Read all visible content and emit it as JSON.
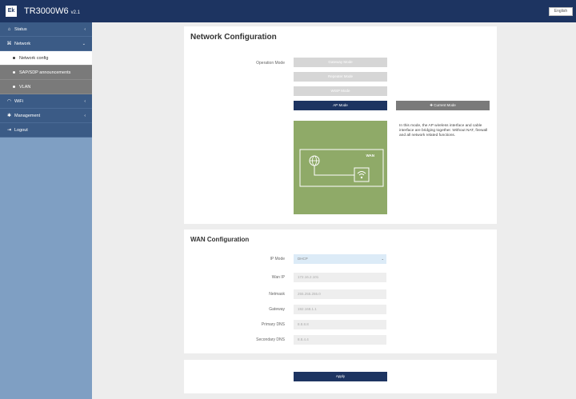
{
  "header": {
    "logo_text": "Ek",
    "product_name": "TR3000W6",
    "version": "v2.1",
    "language": "English"
  },
  "sidebar": {
    "items": [
      {
        "label": "Status",
        "icon": "home-icon",
        "caret": "‹"
      },
      {
        "label": "Network",
        "icon": "network-icon",
        "caret": "⌄"
      },
      {
        "label": "Network config",
        "sub": true,
        "active": true
      },
      {
        "label": "SAP/SDP announcements",
        "sub": true
      },
      {
        "label": "VLAN",
        "sub": true
      },
      {
        "label": "WiFi",
        "icon": "wifi-icon",
        "caret": "‹"
      },
      {
        "label": "Management",
        "icon": "gear-icon",
        "caret": "‹"
      },
      {
        "label": "Logout",
        "icon": "logout-icon"
      }
    ]
  },
  "network_config": {
    "title": "Network Configuration",
    "operation_mode_label": "Operation Mode",
    "modes": [
      "Gateway Mode",
      "Repeater Mode",
      "WISP Mode",
      "AP Mode"
    ],
    "selected_mode": "AP Mode",
    "current_mode_label": "✚ Current Mode",
    "diagram_label": "WAN",
    "description": "In this mode, the AP wireless interface and cable interface are bridging together. Without NAT, firewall and all network related functions."
  },
  "wan_config": {
    "title": "WAN Configuration",
    "ip_mode_label": "IP Mode",
    "ip_mode_value": "DHCP",
    "fields": [
      {
        "label": "Wan IP",
        "value": "172.16.2.101"
      },
      {
        "label": "Netmask",
        "value": "255.255.255.0"
      },
      {
        "label": "Gateway",
        "value": "192.168.1.1"
      },
      {
        "label": "Primary DNS",
        "value": "8.8.8.8"
      },
      {
        "label": "Secondary DNS",
        "value": "8.8.4.4"
      }
    ]
  },
  "actions": {
    "apply_label": "Apply"
  },
  "colors": {
    "header_bg": "#1d3461",
    "sidebar_bg": "#7f9fc3",
    "nav_bg": "#3b5b86",
    "submenu_bg": "#7a7a7a",
    "selected_mode": "#1d3461",
    "diagram_bg": "#8faa68"
  }
}
